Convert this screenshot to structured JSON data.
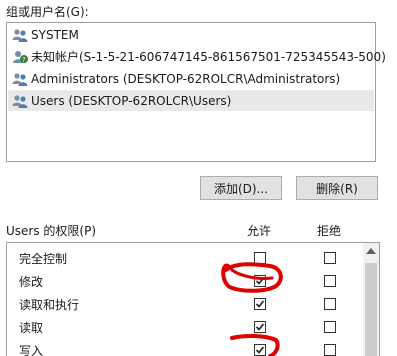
{
  "group_label": "组或用户名(G):",
  "users": [
    {
      "name": "SYSTEM",
      "icon": "user-group-icon",
      "selected": false
    },
    {
      "name": "未知帐户(S-1-5-21-606747145-861567501-725345543-500)",
      "icon": "unknown-user-icon",
      "selected": false
    },
    {
      "name": "Administrators (DESKTOP-62ROLCR\\Administrators)",
      "icon": "user-group-icon",
      "selected": false
    },
    {
      "name": "Users (DESKTOP-62ROLCR\\Users)",
      "icon": "user-group-icon",
      "selected": true
    }
  ],
  "buttons": {
    "add": "添加(D)...",
    "remove": "删除(R)"
  },
  "permissions_header": {
    "title": "Users 的权限(P)",
    "allow": "允许",
    "deny": "拒绝"
  },
  "permissions": [
    {
      "name": "完全控制",
      "allow": false,
      "deny": false
    },
    {
      "name": "修改",
      "allow": true,
      "deny": false
    },
    {
      "name": "读取和执行",
      "allow": true,
      "deny": false
    },
    {
      "name": "读取",
      "allow": true,
      "deny": false
    },
    {
      "name": "写入",
      "allow": true,
      "deny": false
    }
  ],
  "colors": {
    "annotation": "#e00000",
    "selected_row": "#e9e9e9",
    "button_bg": "#e1e1e1"
  }
}
